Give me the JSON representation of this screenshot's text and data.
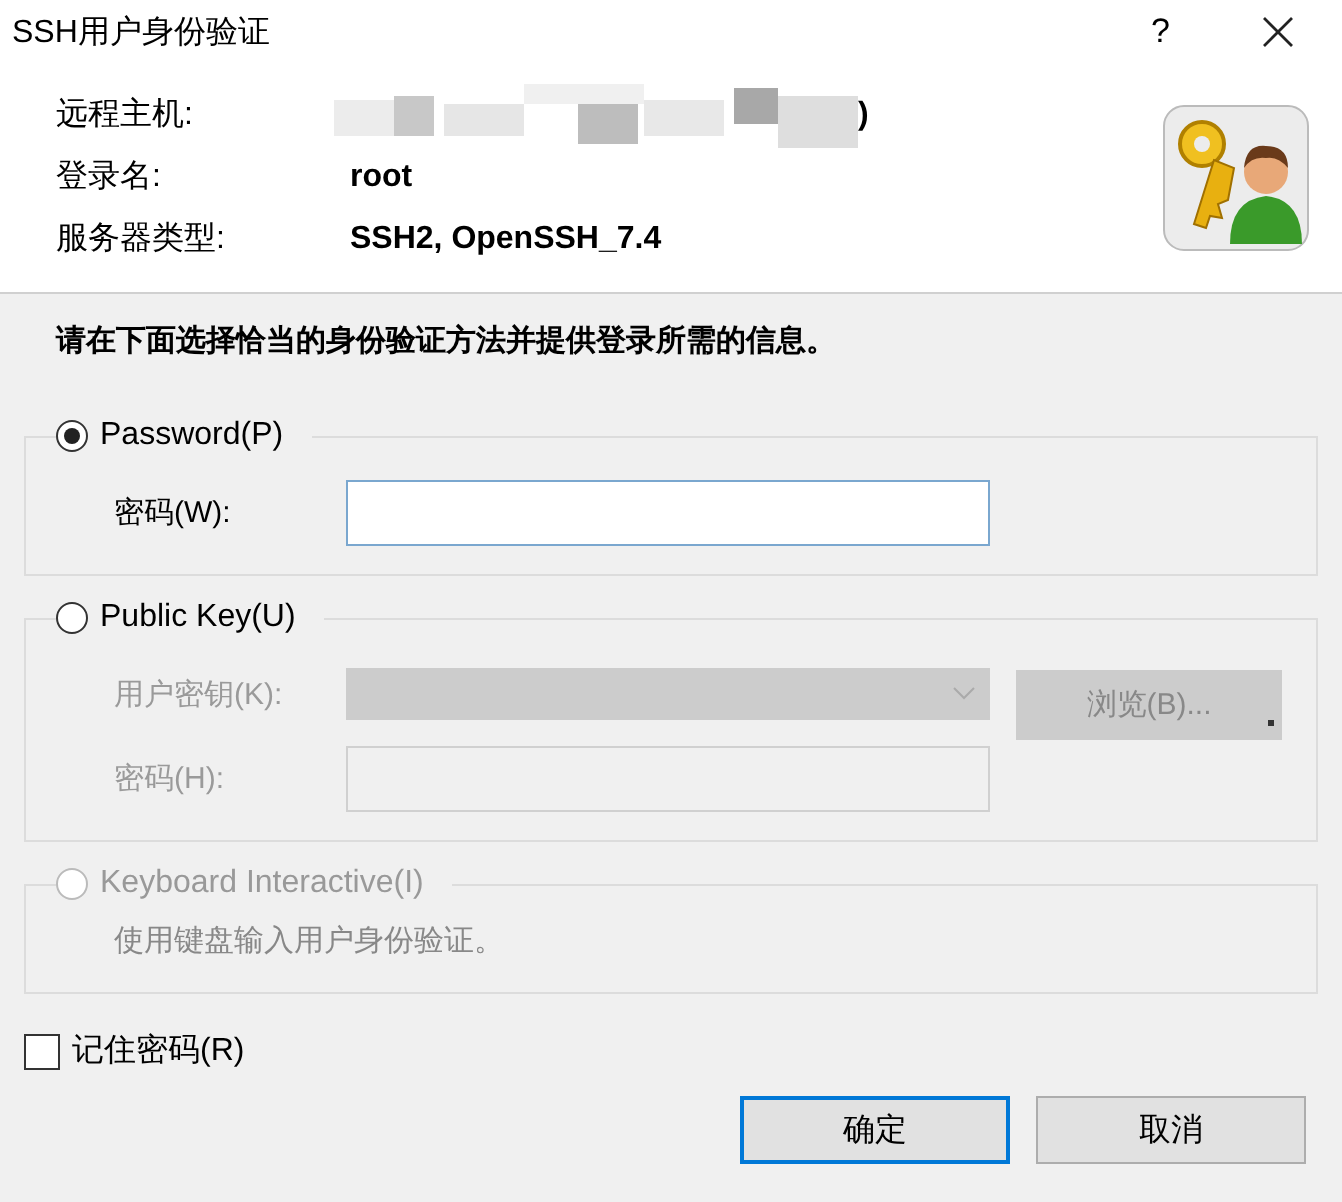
{
  "window": {
    "title": "SSH用户身份验证",
    "help": "?"
  },
  "info": {
    "rows": [
      {
        "label": "远程主机:",
        "value": ")",
        "redacted": true
      },
      {
        "label": "登录名:",
        "value": "root",
        "redacted": false
      },
      {
        "label": "服务器类型:",
        "value": "SSH2, OpenSSH_7.4",
        "redacted": false
      }
    ]
  },
  "instruction": "请在下面选择恰当的身份验证方法并提供登录所需的信息。",
  "methods": [
    {
      "label": "Password(P)",
      "selected": true,
      "disabled": false,
      "fields": [
        {
          "kind": "input",
          "label": "密码(W):",
          "disabled": false
        }
      ]
    },
    {
      "label": "Public Key(U)",
      "selected": false,
      "disabled": false,
      "fields": [
        {
          "kind": "select",
          "label": "用户密钥(K):",
          "disabled": true,
          "button": "浏览(B)..."
        },
        {
          "kind": "input",
          "label": "密码(H):",
          "disabled": true
        }
      ]
    },
    {
      "label": "Keyboard Interactive(I)",
      "selected": false,
      "disabled": true,
      "note": "使用键盘输入用户身份验证。"
    }
  ],
  "remember": {
    "label": "记住密码(R)",
    "checked": false
  },
  "buttons": [
    {
      "label": "确定",
      "default": true
    },
    {
      "label": "取消",
      "default": false
    }
  ]
}
